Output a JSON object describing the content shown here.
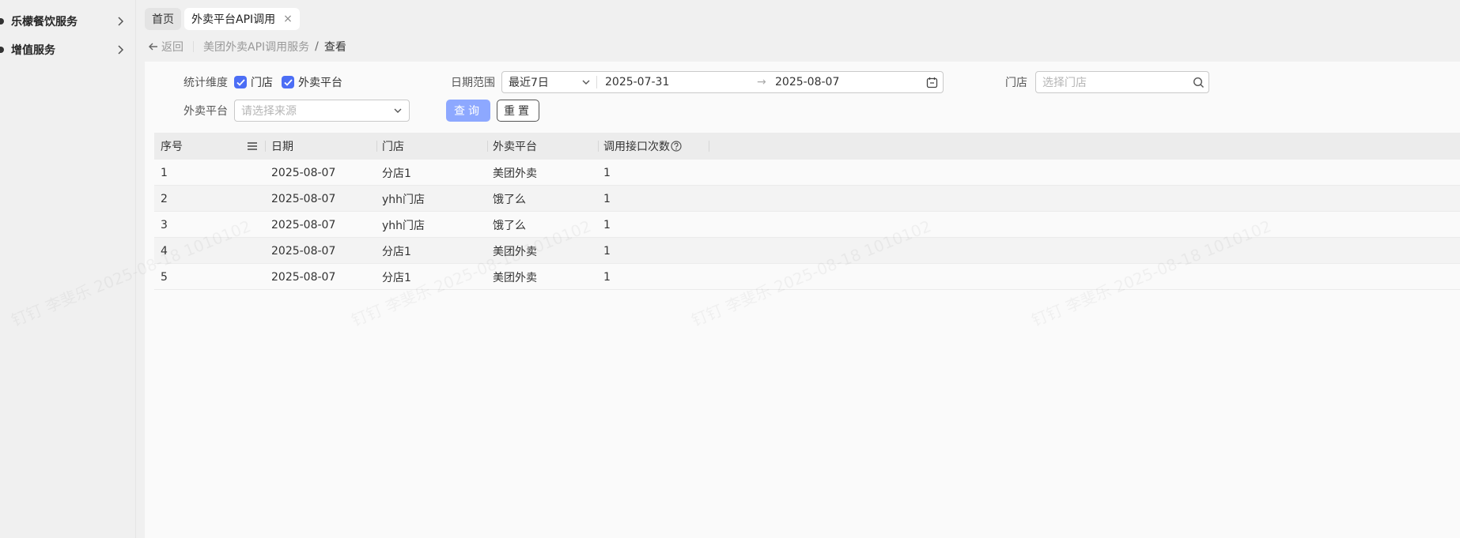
{
  "sidebar": {
    "items": [
      {
        "label": "乐檬餐饮服务"
      },
      {
        "label": "增值服务"
      }
    ]
  },
  "tabs": [
    {
      "label": "首页",
      "active": false
    },
    {
      "label": "外卖平台API调用",
      "active": true,
      "close": "×"
    }
  ],
  "breadcrumb": {
    "back_label": "返回",
    "items": [
      "美团外卖API调用服务",
      "查看"
    ],
    "separator": "/"
  },
  "filters": {
    "dimension_label": "统计维度",
    "dimension_options": [
      {
        "label": "门店",
        "checked": true
      },
      {
        "label": "外卖平台",
        "checked": true
      }
    ],
    "date_range_label": "日期范围",
    "date_preset": "最近7日",
    "date_start": "2025-07-31",
    "date_arrow": "→",
    "date_end": "2025-08-07",
    "store_label": "门店",
    "store_placeholder": "选择门店",
    "platform_label": "外卖平台",
    "platform_placeholder": "请选择来源",
    "query_button": "查询",
    "reset_button": "重置"
  },
  "table": {
    "columns": [
      "序号",
      "日期",
      "门店",
      "外卖平台",
      "调用接口次数"
    ],
    "rows": [
      [
        "1",
        "2025-08-07",
        "分店1",
        "美团外卖",
        "1"
      ],
      [
        "2",
        "2025-08-07",
        "yhh门店",
        "饿了么",
        "1"
      ],
      [
        "3",
        "2025-08-07",
        "yhh门店",
        "饿了么",
        "1"
      ],
      [
        "4",
        "2025-08-07",
        "分店1",
        "美团外卖",
        "1"
      ],
      [
        "5",
        "2025-08-07",
        "分店1",
        "美团外卖",
        "1"
      ]
    ]
  },
  "watermark": "钉钉 李斐乐 2025-08-18 1010102",
  "colors": {
    "accent": "#4c6ef5",
    "primary_button": "#8da8ff"
  }
}
